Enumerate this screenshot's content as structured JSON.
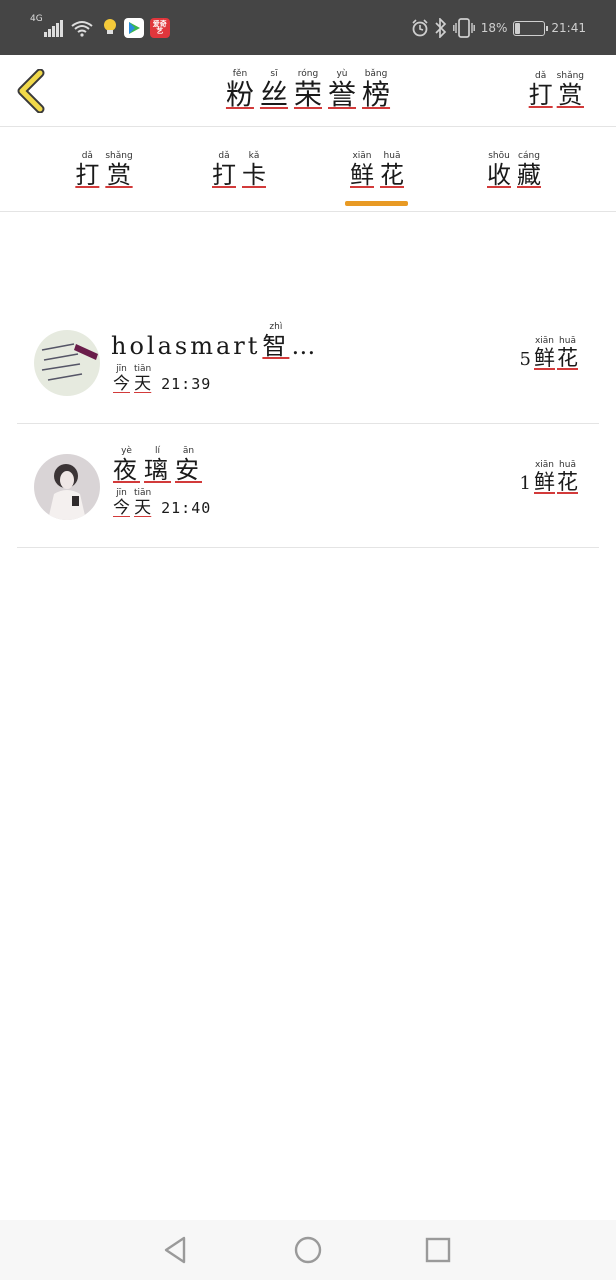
{
  "status_bar": {
    "network": "4G",
    "app_badge_red": "爱奇艺",
    "battery_text": "18%",
    "battery_level": 0.18,
    "time": "21:41"
  },
  "header": {
    "title": [
      {
        "char": "粉",
        "pinyin": "fěn"
      },
      {
        "char": "丝",
        "pinyin": "sī"
      },
      {
        "char": "荣",
        "pinyin": "róng"
      },
      {
        "char": "誉",
        "pinyin": "yù"
      },
      {
        "char": "榜",
        "pinyin": "bǎng"
      }
    ],
    "right_action": [
      {
        "char": "打",
        "pinyin": "dǎ"
      },
      {
        "char": "赏",
        "pinyin": "shǎng"
      }
    ]
  },
  "tabs": [
    {
      "chars": [
        {
          "char": "打",
          "pinyin": "dǎ"
        },
        {
          "char": "赏",
          "pinyin": "shǎng"
        }
      ]
    },
    {
      "chars": [
        {
          "char": "打",
          "pinyin": "dǎ"
        },
        {
          "char": "卡",
          "pinyin": "kǎ"
        }
      ]
    },
    {
      "chars": [
        {
          "char": "鲜",
          "pinyin": "xiān"
        },
        {
          "char": "花",
          "pinyin": "huā"
        }
      ],
      "active": true
    },
    {
      "chars": [
        {
          "char": "收",
          "pinyin": "shōu"
        },
        {
          "char": "藏",
          "pinyin": "cáng"
        }
      ]
    }
  ],
  "list": [
    {
      "name_latin": "holasmart",
      "name_chars": [
        {
          "char": "智",
          "pinyin": "zhì"
        }
      ],
      "name_suffix": "…",
      "day": [
        {
          "char": "今",
          "pinyin": "jīn"
        },
        {
          "char": "天",
          "pinyin": "tiān"
        }
      ],
      "time": "21:39",
      "count": "5",
      "unit": [
        {
          "char": "鲜",
          "pinyin": "xiān"
        },
        {
          "char": "花",
          "pinyin": "huā"
        }
      ]
    },
    {
      "name_latin": "",
      "name_chars": [
        {
          "char": "夜",
          "pinyin": "yè"
        },
        {
          "char": "璃",
          "pinyin": "lí"
        },
        {
          "char": "安",
          "pinyin": "ān"
        }
      ],
      "name_suffix": "",
      "day": [
        {
          "char": "今",
          "pinyin": "jīn"
        },
        {
          "char": "天",
          "pinyin": "tiān"
        }
      ],
      "time": "21:40",
      "count": "1",
      "unit": [
        {
          "char": "鲜",
          "pinyin": "xiān"
        },
        {
          "char": "花",
          "pinyin": "huā"
        }
      ]
    }
  ],
  "colors": {
    "status_bar": "#454545",
    "accent": "#e89a24",
    "underline": "#d23a3a",
    "back_arrow": "#f1d94a"
  }
}
